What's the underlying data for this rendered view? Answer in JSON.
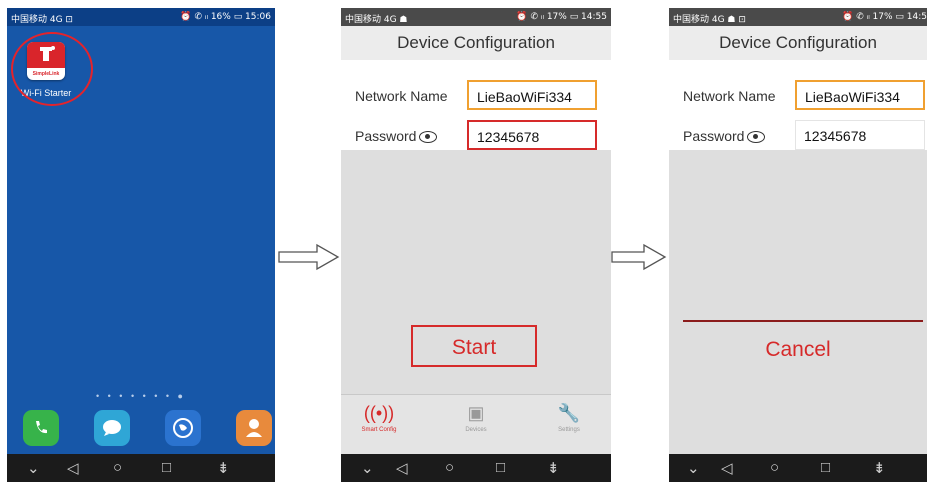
{
  "phone1": {
    "status_left": "中国移动 4G ⊡",
    "status_right": "⏰ ✆ ᵢₗ 16% ▭ 15:06",
    "app_icon_text": "SimpleLink",
    "app_label": "Wi-Fi Starter",
    "page_dots": "• • • • • • • ●"
  },
  "phone2": {
    "status_left": "中国移动 4G ☗",
    "status_right": "⏰ ✆ ᵢₗ 17% ▭ 14:55",
    "title": "Device Configuration",
    "network_label": "Network Name",
    "network_value": "LieBaoWiFi334",
    "password_label": "Password",
    "password_value": "12345678",
    "start_button": "Start",
    "tabs": [
      "Smart Config",
      "Devices",
      "Settings"
    ]
  },
  "phone3": {
    "status_left": "中国移动 4G ☗ ⊡",
    "status_right": "⏰ ✆ ᵢₗ 17% ▭ 14:5",
    "title": "Device Configuration",
    "network_label": "Network Name",
    "network_value": "LieBaoWiFi334",
    "password_label": "Password",
    "password_value": "12345678",
    "cancel_button": "Cancel"
  },
  "colors": {
    "highlight_red": "#d62a2a",
    "home_blue": "#1757a8",
    "input_orange": "#f0a030"
  },
  "icons": [
    "phone-icon",
    "message-icon",
    "browser-icon",
    "contacts-icon",
    "back-icon",
    "home-icon",
    "recents-icon",
    "notification-icon",
    "eye-icon",
    "wifi-signal-icon",
    "device-icon",
    "wrench-icon"
  ]
}
